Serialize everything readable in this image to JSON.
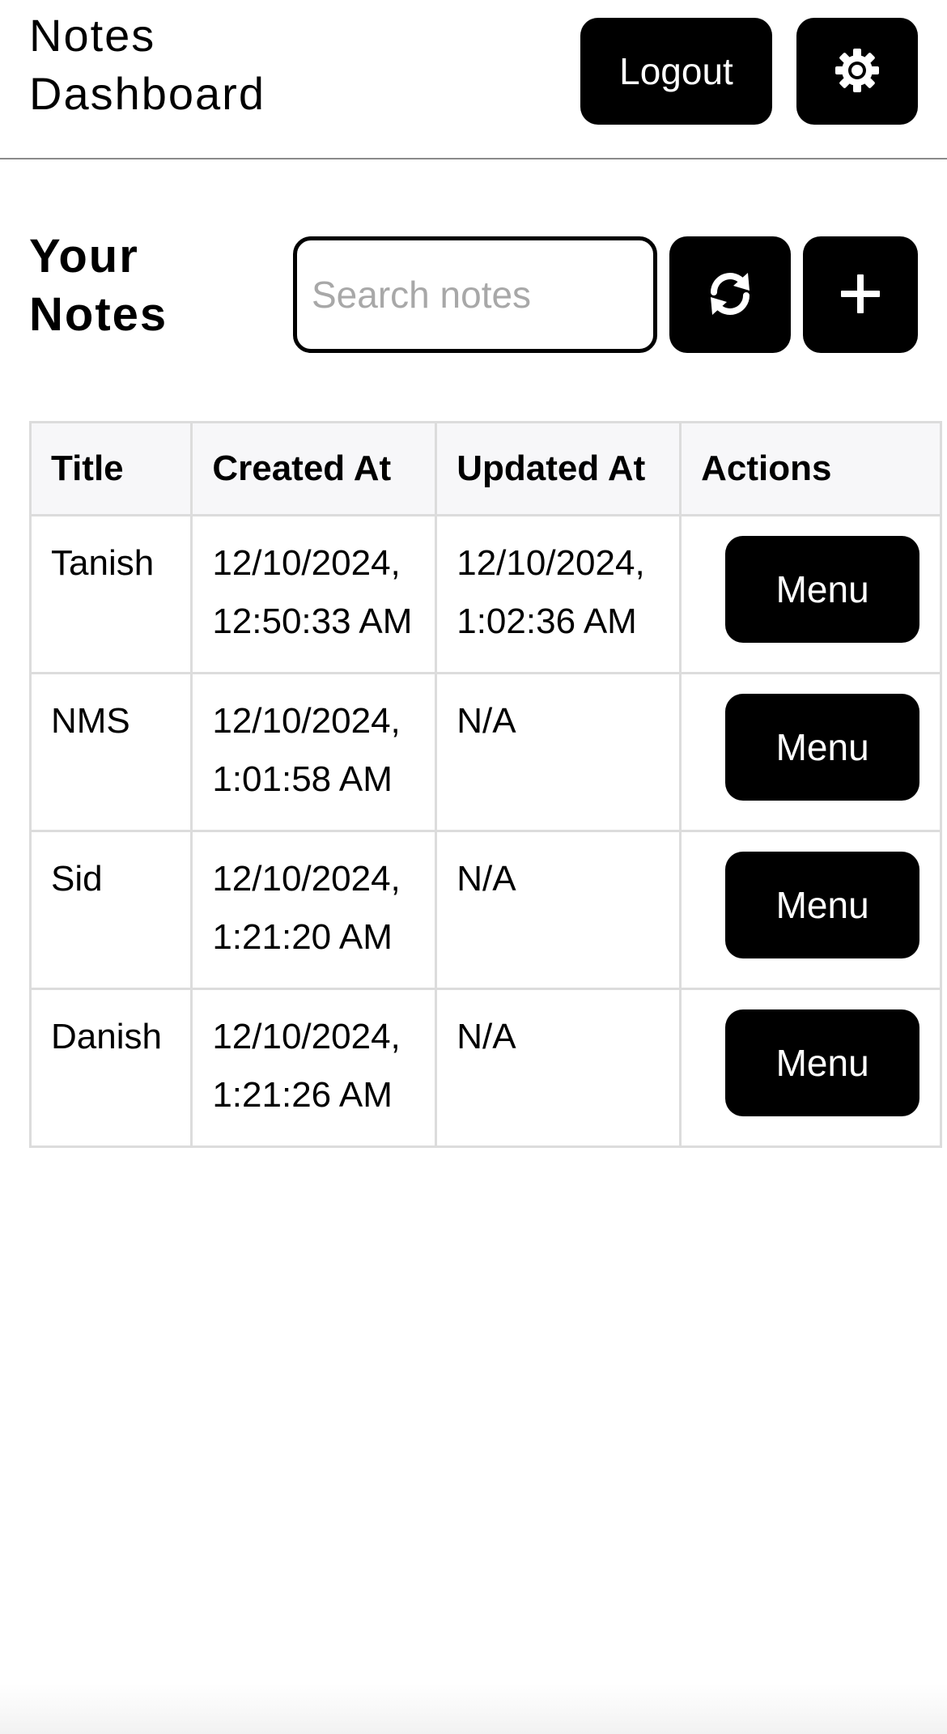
{
  "header": {
    "app_title": "Notes Dashboard",
    "logout_label": "Logout",
    "settings_icon": "gear-icon"
  },
  "notes_section": {
    "title": "Your Notes",
    "search_placeholder": "Search notes",
    "search_value": "",
    "refresh_icon": "refresh-icon",
    "add_icon": "plus-icon"
  },
  "table": {
    "columns": [
      "Title",
      "Created At",
      "Updated At",
      "Actions"
    ],
    "rows": [
      {
        "title": "Tanish",
        "created": "12/10/2024, 12:50:33 AM",
        "updated": "12/10/2024, 1:02:36 AM",
        "action": "Menu"
      },
      {
        "title": "NMS",
        "created": "12/10/2024, 1:01:58 AM",
        "updated": "N/A",
        "action": "Menu"
      },
      {
        "title": "Sid",
        "created": "12/10/2024, 1:21:20 AM",
        "updated": "N/A",
        "action": "Menu"
      },
      {
        "title": "Danish",
        "created": "12/10/2024, 1:21:26 AM",
        "updated": "N/A",
        "action": "Menu"
      }
    ]
  }
}
